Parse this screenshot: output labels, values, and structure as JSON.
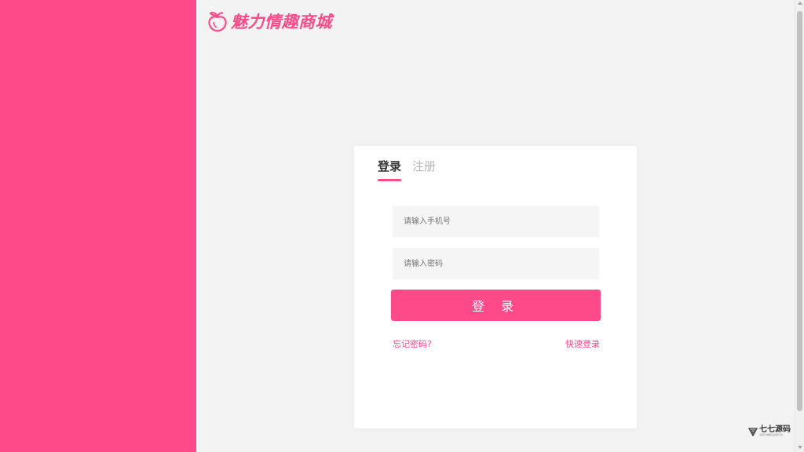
{
  "brand": {
    "logo_text": "魅力情趣商城",
    "accent_color": "#ff4a8a",
    "logo_icon": "peach-icon"
  },
  "tabs": [
    {
      "label": "登录",
      "active": true
    },
    {
      "label": "注册",
      "active": false
    }
  ],
  "form": {
    "phone_placeholder": "请输入手机号",
    "phone_value": "",
    "password_placeholder": "请输入密码",
    "password_value": "",
    "login_label": "登 录",
    "forgot_label": "忘记密码?",
    "quick_login_label": "快速登录"
  },
  "watermark": {
    "title": "七七源码",
    "subtitle": "全网大神都在这里分享",
    "icon": "triangle-logo-icon"
  }
}
